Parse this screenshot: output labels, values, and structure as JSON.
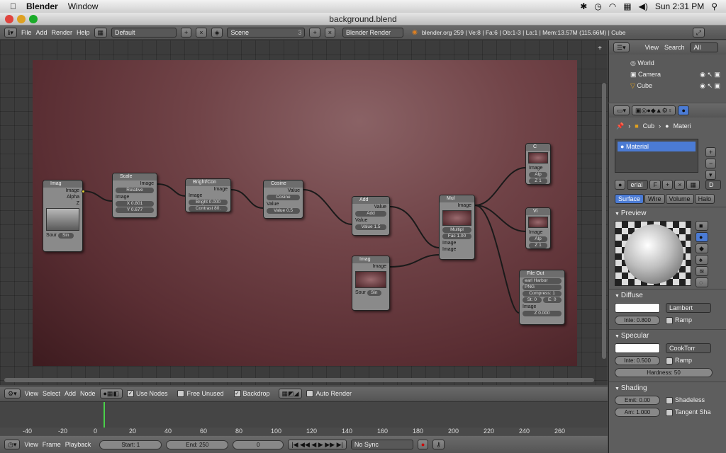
{
  "mac_menubar": {
    "apple": "",
    "app": "Blender",
    "items": [
      "Window"
    ],
    "clock": "Sun 2:31 PM"
  },
  "window": {
    "title": "background.blend"
  },
  "info_header": {
    "menus": [
      "File",
      "Add",
      "Render",
      "Help"
    ],
    "layout": "Default",
    "scene": "Scene",
    "scene_count": "3",
    "engine": "Blender Render",
    "stats": "blender.org 259 | Ve:8 | Fa:6 | Ob:1-3 | La:1 | Mem:13.57M (115.66M) | Cube"
  },
  "nodes": {
    "image1": {
      "title": "Imag",
      "outputs": [
        "Image",
        "Alpha",
        "Z"
      ],
      "fields": [
        "Sour",
        "Sin"
      ]
    },
    "scale": {
      "title": "Scale",
      "output": "Image",
      "mode": "Relative",
      "input": "Image",
      "x": "X 0.801",
      "y": "Y 0.677"
    },
    "bright": {
      "title": "Bright/Con",
      "output": "Image",
      "input": "Image",
      "bright": "Bright 0.000",
      "contrast": "Contrast 80."
    },
    "cosine": {
      "title": "Cosine",
      "output": "Value",
      "mode": "Cosine",
      "input": "Value",
      "value": "Value 0.5"
    },
    "add": {
      "title": "Add",
      "output": "Value",
      "mode": "Add",
      "input": "Value",
      "value": "Value 1.5"
    },
    "image2": {
      "title": "Imag",
      "output": "Image",
      "fields": [
        "Sour",
        "Sin"
      ]
    },
    "mul": {
      "title": "Mul",
      "output": "Image",
      "mode": "Multipl",
      "fac": "Fac 1.00",
      "inputs": [
        "Image",
        "Image"
      ]
    },
    "composite": {
      "title": "C",
      "input": "Image",
      "alpha": "Alp",
      "z": "Z 1"
    },
    "viewer": {
      "title": "Vi",
      "input": "Image",
      "alpha": "Alp",
      "z": "Z 1"
    },
    "fileout": {
      "title": "File Out",
      "path": "earl Harbor",
      "format": "PNG",
      "compress": "Compress: 1",
      "start": "St: 0",
      "end": "E: 0",
      "input": "Image",
      "z": "Z 0.000"
    }
  },
  "node_header": {
    "menus": [
      "View",
      "Select",
      "Add",
      "Node"
    ],
    "use_nodes": "Use Nodes",
    "free_unused": "Free Unused",
    "backdrop": "Backdrop",
    "auto_render": "Auto Render"
  },
  "timeline": {
    "ticks": [
      "-40",
      "-20",
      "0",
      "20",
      "40",
      "60",
      "80",
      "100",
      "120",
      "140",
      "160",
      "180",
      "200",
      "220",
      "240",
      "260"
    ],
    "current": "0"
  },
  "timeline_header": {
    "menus": [
      "View",
      "Frame",
      "Playback"
    ],
    "start": "Start: 1",
    "end": "End: 250",
    "frame": "0",
    "sync": "No Sync"
  },
  "outliner": {
    "menus": [
      "View",
      "Search"
    ],
    "filter": "All Scene",
    "items": [
      "World",
      "Camera",
      "Cube"
    ]
  },
  "properties": {
    "breadcrumb": [
      "Cub",
      "Materi"
    ],
    "material": "Material",
    "mat_field": "erial",
    "mat_f": "F",
    "mat_d": "D",
    "tabs": [
      "Surface",
      "Wire",
      "Volume",
      "Halo"
    ],
    "preview": "Preview",
    "diffuse": {
      "label": "Diffuse",
      "shader": "Lambert",
      "intensity": "Inte: 0.800",
      "ramp": "Ramp"
    },
    "specular": {
      "label": "Specular",
      "shader": "CookTorr",
      "intensity": "Inte: 0.500",
      "ramp": "Ramp",
      "hardness": "Hardness: 50"
    },
    "shading": {
      "label": "Shading",
      "emit": "Emit: 0.00",
      "shadeless": "Shadeless",
      "amb": "Am: 1.000",
      "tangent": "Tangent Sha"
    }
  },
  "colors": {
    "accent": "#4b7bd4",
    "socket": "#e0c830",
    "backdrop": "#6a3c40"
  }
}
